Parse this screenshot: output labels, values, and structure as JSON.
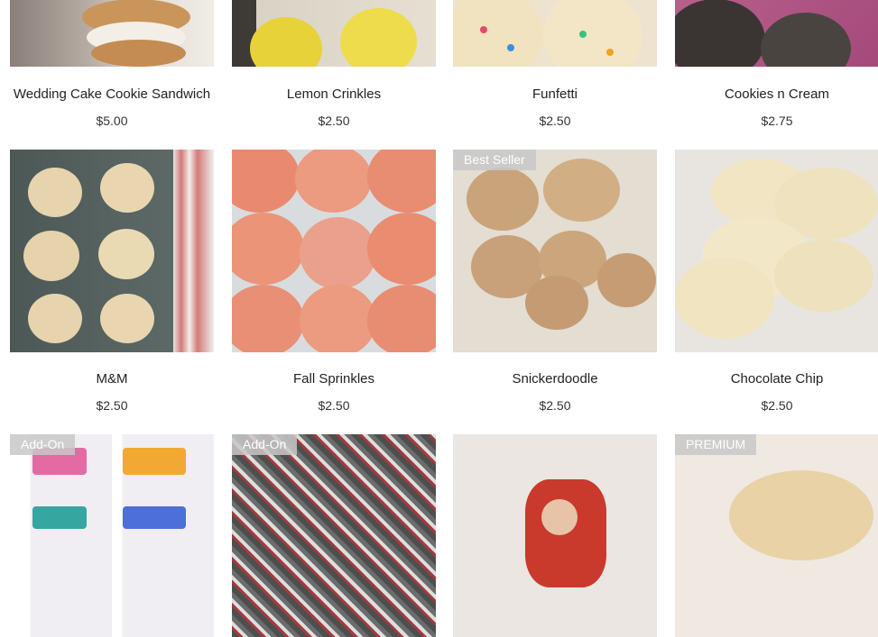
{
  "products": [
    {
      "name": "Wedding Cake Cookie Sandwich",
      "price": "$5.00",
      "ribbon": "",
      "image": "wedding-cake-cookie-image"
    },
    {
      "name": "Lemon Crinkles",
      "price": "$2.50",
      "ribbon": "",
      "image": "lemon-crinkles-image"
    },
    {
      "name": "Funfetti",
      "price": "$2.50",
      "ribbon": "",
      "image": "funfetti-image"
    },
    {
      "name": "Cookies n Cream",
      "price": "$2.75",
      "ribbon": "",
      "image": "cookies-n-cream-image"
    },
    {
      "name": "M&M",
      "price": "$2.50",
      "ribbon": "",
      "image": "mm-cookie-image"
    },
    {
      "name": "Fall Sprinkles",
      "price": "$2.50",
      "ribbon": "",
      "image": "fall-sprinkles-image"
    },
    {
      "name": "Snickerdoodle",
      "price": "$2.50",
      "ribbon": "Best Seller",
      "image": "snickerdoodle-image"
    },
    {
      "name": "Chocolate Chip",
      "price": "$2.50",
      "ribbon": "",
      "image": "chocolate-chip-image"
    },
    {
      "name": "",
      "price": "",
      "ribbon": "Add-On",
      "image": "birthday-toppers-image"
    },
    {
      "name": "",
      "price": "",
      "ribbon": "Add-On",
      "image": "sprinkle-mix-image"
    },
    {
      "name": "",
      "price": "",
      "ribbon": "",
      "image": "holiday-cookie-image"
    },
    {
      "name": "",
      "price": "",
      "ribbon": "PREMIUM",
      "image": "premium-cookie-image"
    }
  ],
  "colors": {
    "ribbon_bg": "#c8c8c8",
    "ribbon_text": "#ffffff",
    "text": "#222222"
  }
}
